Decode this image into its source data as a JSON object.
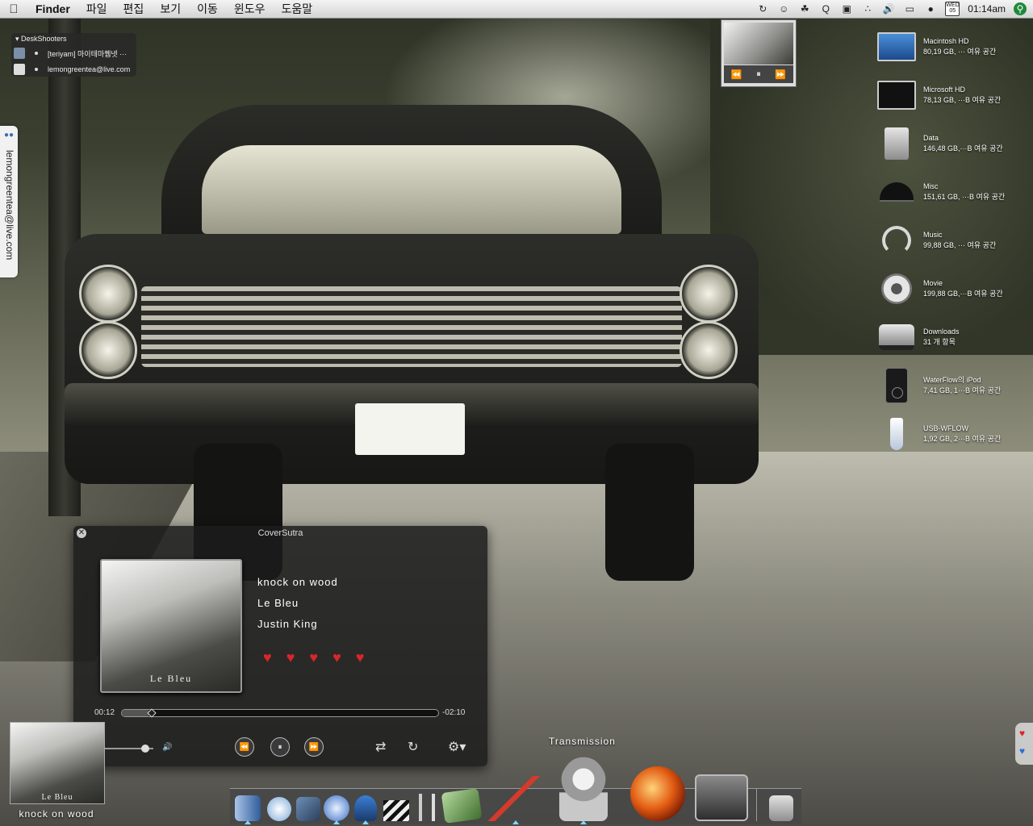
{
  "menubar": {
    "app_name": "Finder",
    "menus": [
      "파일",
      "편집",
      "보기",
      "이동",
      "윈도우",
      "도움말"
    ],
    "date_badge_day": "WED",
    "date_badge_num": "05",
    "clock": "01:14am"
  },
  "deskshooters": {
    "title": "DeskShooters",
    "contacts": [
      {
        "name": "[teriyam] 마이테마퀨넷 ···"
      },
      {
        "name": "lemongreentea@live.com"
      }
    ]
  },
  "side_tab": {
    "label": "lemongreentea@live.com"
  },
  "volumes": [
    {
      "name": "Macintosh HD",
      "info": "80,19 GB, ··· 여유 공간",
      "icon": "monitor-icon"
    },
    {
      "name": "Microsoft HD",
      "info": "78,13 GB, ···B 여유 공간",
      "icon": "monitor-black-icon"
    },
    {
      "name": "Data",
      "info": "146,48 GB,···B 여유 공간",
      "icon": "hard-drive-icon"
    },
    {
      "name": "Misc",
      "info": "151,61 GB, ···B 여유 공간",
      "icon": "umbrella-icon"
    },
    {
      "name": "Music",
      "info": "99,88 GB, ··· 여유 공간",
      "icon": "headphones-icon"
    },
    {
      "name": "Movie",
      "info": "199,88 GB,···B 여유 공간",
      "icon": "film-reel-icon"
    },
    {
      "name": "Downloads",
      "info": "31 개 항목",
      "icon": "van-icon"
    },
    {
      "name": "WaterFlow의 iPod",
      "info": "7,41 GB, 1···B 여유 공간",
      "icon": "ipod-icon"
    },
    {
      "name": "USB-WFLOW",
      "info": "1,92 GB, 2···B 여유 공간",
      "icon": "usb-drive-icon"
    }
  ],
  "coversutra": {
    "window_title": "CoverSutra",
    "album_art_caption": "Le Bleu",
    "track": "knock on wood",
    "album": "Le Bleu",
    "artist": "Justin King",
    "rating": 5,
    "elapsed": "00:12",
    "remaining": "-02:10",
    "progress_fraction": 0.09,
    "volume_fraction": 0.85
  },
  "now_playing": {
    "art_caption": "Le Bleu",
    "title": "knock on wood"
  },
  "dock": {
    "label": "Transmission",
    "accent": "#7fd6ff"
  }
}
